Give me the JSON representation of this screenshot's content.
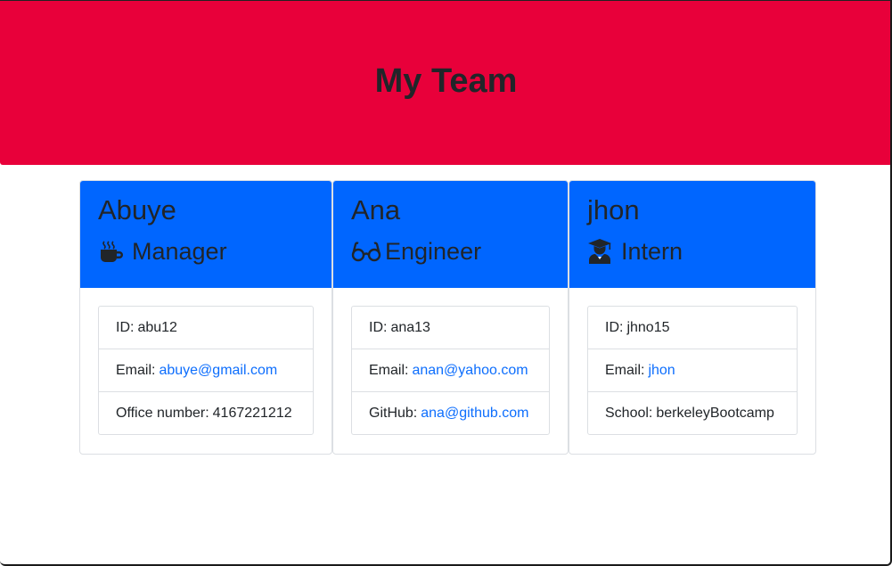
{
  "header": {
    "title": "My Team"
  },
  "colors": {
    "hero_background": "#e8003a",
    "card_header_background": "#0066ff",
    "link": "#0d6efd"
  },
  "employees": [
    {
      "name": "Abuye",
      "role": "Manager",
      "role_icon": "mug-hot-icon",
      "id_label": "ID:",
      "id": "abu12",
      "email_label": "Email:",
      "email": "abuye@gmail.com",
      "extra_label": "Office number:",
      "extra_value": "4167221212"
    },
    {
      "name": "Ana",
      "role": "Engineer",
      "role_icon": "glasses-icon",
      "id_label": "ID:",
      "id": "ana13",
      "email_label": "Email:",
      "email": "anan@yahoo.com",
      "extra_label": "GitHub:",
      "extra_value": "ana@github.com"
    },
    {
      "name": "jhon",
      "role": "Intern",
      "role_icon": "user-graduate-icon",
      "id_label": "ID:",
      "id": "jhno15",
      "email_label": "Email:",
      "email": "jhon",
      "extra_label": "School:",
      "extra_value": "berkeleyBootcamp"
    }
  ]
}
